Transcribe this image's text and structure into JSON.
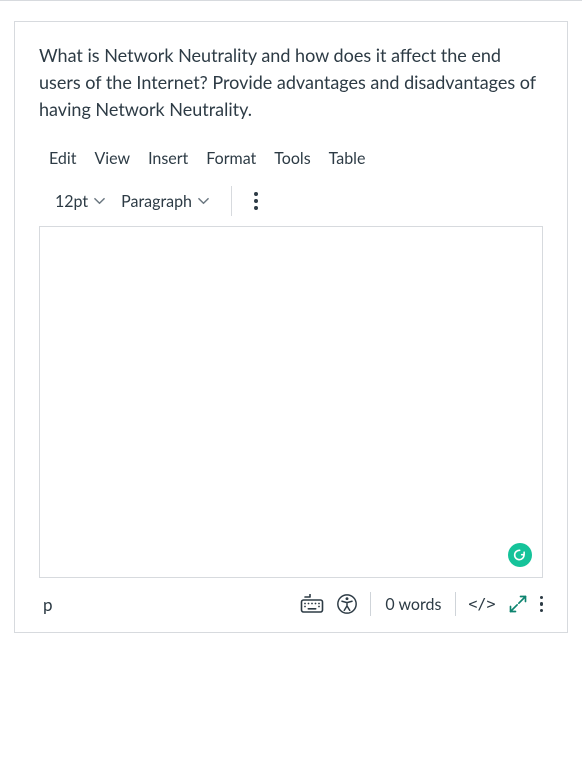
{
  "prompt": "What is Network Neutrality and how does it affect the end users of the Internet? Provide advantages and disadvantages of having Network Neutrality.",
  "menubar": {
    "edit": "Edit",
    "view": "View",
    "insert": "Insert",
    "format": "Format",
    "tools": "Tools",
    "table": "Table"
  },
  "toolbar": {
    "fontsize": "12pt",
    "blocktype": "Paragraph"
  },
  "status": {
    "path": "p",
    "wordcount": "0 words",
    "code": "</>"
  }
}
